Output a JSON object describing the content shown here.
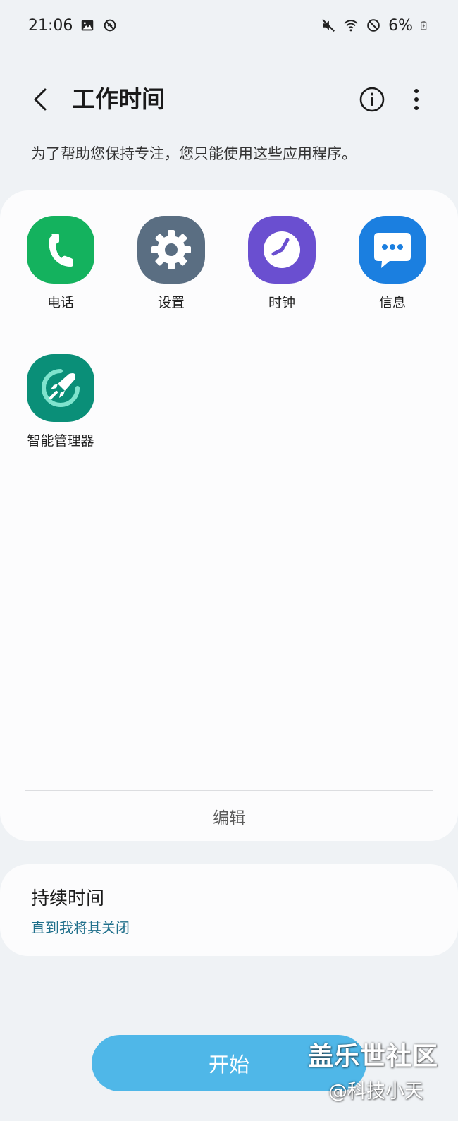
{
  "status_bar": {
    "time": "21:06",
    "battery": "6%",
    "left_icons": [
      "gallery-icon",
      "data-saver-icon"
    ],
    "right_icons": [
      "mute-icon",
      "wifi-icon",
      "do-not-disturb-icon",
      "battery-icon"
    ]
  },
  "header": {
    "title": "工作时间",
    "back_icon": "chevron-left-icon",
    "info_icon": "info-icon",
    "more_icon": "more-vertical-icon"
  },
  "subtitle": "为了帮助您保持专注，您只能使用这些应用程序。",
  "apps": [
    {
      "label": "电话",
      "icon": "phone-icon",
      "color": "#14b25e"
    },
    {
      "label": "设置",
      "icon": "gear-icon",
      "color": "#5a6e82"
    },
    {
      "label": "时钟",
      "icon": "clock-icon",
      "color": "#6a4fd0"
    },
    {
      "label": "信息",
      "icon": "message-icon",
      "color": "#1b7fe0"
    },
    {
      "label": "智能管理器",
      "icon": "rocket-icon",
      "color": "#0a8f78"
    }
  ],
  "edit_label": "编辑",
  "duration": {
    "title": "持续时间",
    "value": "直到我将其关闭"
  },
  "start_label": "开始",
  "watermark": {
    "line1": "盖乐世社区",
    "line2": "@科技小天"
  },
  "colors": {
    "background": "#eff2f5",
    "card": "#fcfcfd",
    "accent_link": "#1f6f8b",
    "start_button": "#4fb7e8"
  }
}
